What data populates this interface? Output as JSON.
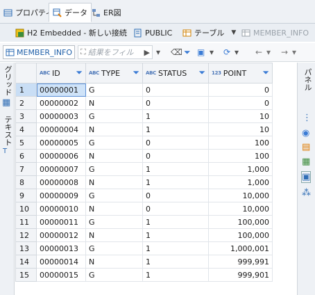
{
  "tabs": [
    {
      "label": "プロパティ",
      "icon": "properties-icon",
      "active": false
    },
    {
      "label": "データ",
      "icon": "data-icon",
      "active": true
    },
    {
      "label": "ER図",
      "icon": "er-diagram-icon",
      "active": false
    }
  ],
  "breadcrumb": {
    "connection": "H2 Embedded - 新しい接続",
    "schema": "PUBLIC",
    "type": "テーブル",
    "table": "MEMBER_INFO"
  },
  "toolbar": {
    "table_name": "MEMBER_INFO",
    "filter_placeholder": "結果をフィル"
  },
  "left_tabs": {
    "grid": "グリッド",
    "text": "テキスト"
  },
  "right_tabs": {
    "panels": "パネル"
  },
  "columns": [
    {
      "name": "ID",
      "type": "ABC"
    },
    {
      "name": "TYPE",
      "type": "ABC"
    },
    {
      "name": "STATUS",
      "type": "ABC"
    },
    {
      "name": "POINT",
      "type": "123"
    }
  ],
  "rows": [
    [
      "1",
      "00000001",
      "G",
      "0",
      "0"
    ],
    [
      "2",
      "00000002",
      "N",
      "0",
      "0"
    ],
    [
      "3",
      "00000003",
      "G",
      "1",
      "10"
    ],
    [
      "4",
      "00000004",
      "N",
      "1",
      "10"
    ],
    [
      "5",
      "00000005",
      "G",
      "0",
      "100"
    ],
    [
      "6",
      "00000006",
      "N",
      "0",
      "100"
    ],
    [
      "7",
      "00000007",
      "G",
      "1",
      "1,000"
    ],
    [
      "8",
      "00000008",
      "N",
      "1",
      "1,000"
    ],
    [
      "9",
      "00000009",
      "G",
      "0",
      "10,000"
    ],
    [
      "10",
      "00000010",
      "N",
      "0",
      "10,000"
    ],
    [
      "11",
      "00000011",
      "G",
      "1",
      "100,000"
    ],
    [
      "12",
      "00000012",
      "N",
      "1",
      "100,000"
    ],
    [
      "13",
      "00000013",
      "G",
      "1",
      "1,000,001"
    ],
    [
      "14",
      "00000014",
      "N",
      "1",
      "999,991"
    ],
    [
      "15",
      "00000015",
      "G",
      "1",
      "999,901"
    ]
  ],
  "colors": {
    "accent": "#3a7bd5",
    "selection": "#cfe3f8",
    "header_bg": "#f2f4f7"
  }
}
